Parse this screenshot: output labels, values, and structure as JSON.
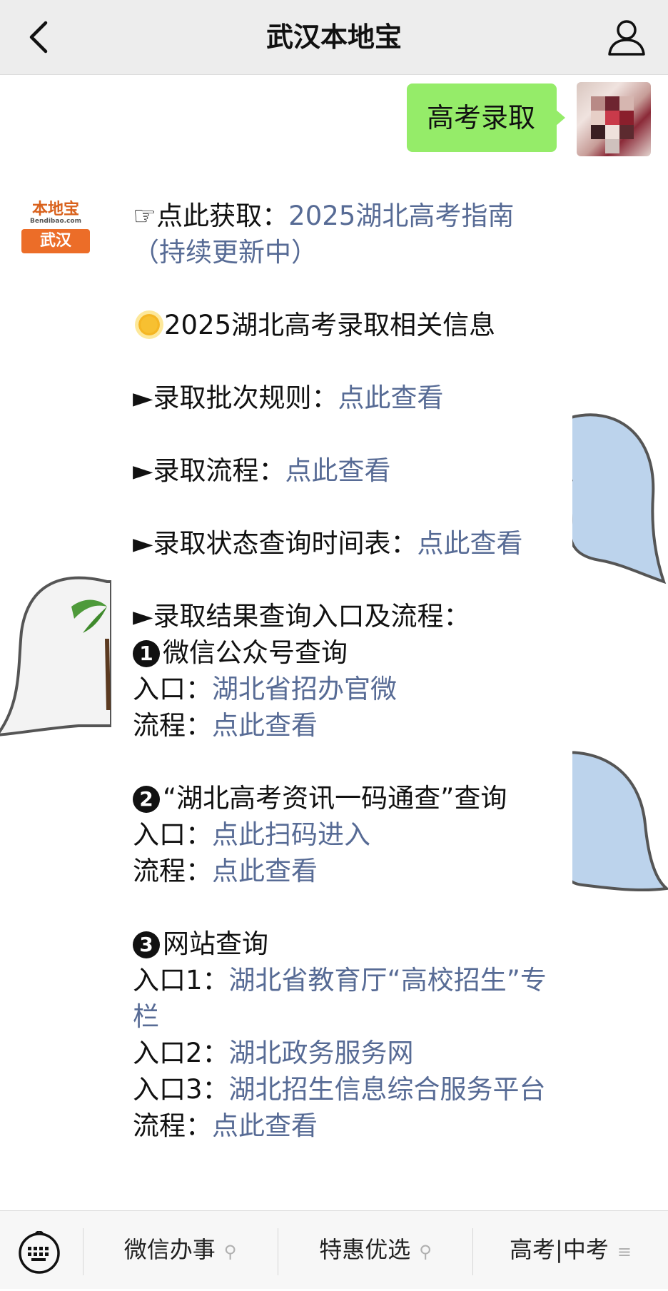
{
  "navbar": {
    "title": "武汉本地宝"
  },
  "outgoing": {
    "text": "高考录取"
  },
  "bot": {
    "logo_top": "本地宝",
    "logo_sub": "Bendibao.com",
    "logo_bottom": "武汉"
  },
  "message": {
    "guide_prefix": "☞点此获取：",
    "guide_link": "2025湖北高考指南（持续更新中）",
    "info_title": "2025湖北高考录取相关信息",
    "batch_label": "►录取批次规则：",
    "batch_link": "点此查看",
    "process_label": "►录取流程：",
    "process_link": "点此查看",
    "status_label": "►录取状态查询时间表：",
    "status_link": "点此查看",
    "result_label": "►录取结果查询入口及流程：",
    "m1_num": "1",
    "m1_title": "微信公众号查询",
    "m1_entry_label": "入口：",
    "m1_entry_link": "湖北省招办官微",
    "m1_flow_label": "流程：",
    "m1_flow_link": "点此查看",
    "m2_num": "2",
    "m2_title": "“湖北高考资讯一码通查”查询",
    "m2_entry_label": "入口：",
    "m2_entry_link": "点此扫码进入",
    "m2_flow_label": "流程：",
    "m2_flow_link": "点此查看",
    "m3_num": "3",
    "m3_title": "网站查询",
    "m3_entry1_label": "入口1：",
    "m3_entry1_link": "湖北省教育厅“高校招生”专栏",
    "m3_entry2_label": "入口2：",
    "m3_entry2_link": "湖北政务服务网",
    "m3_entry3_label": "入口3：",
    "m3_entry3_link": "湖北招生信息综合服务平台",
    "m3_flow_label": "流程：",
    "m3_flow_link": "点此查看"
  },
  "menu": {
    "items": [
      {
        "label": "微信办事",
        "icon": "link-icon"
      },
      {
        "label": "特惠优选",
        "icon": "link-icon"
      },
      {
        "label": "高考|中考",
        "icon": "submenu-icon"
      }
    ]
  },
  "colors": {
    "link": "#576b95",
    "out_bubble": "#95ec69",
    "brand": "#ec6d28"
  }
}
